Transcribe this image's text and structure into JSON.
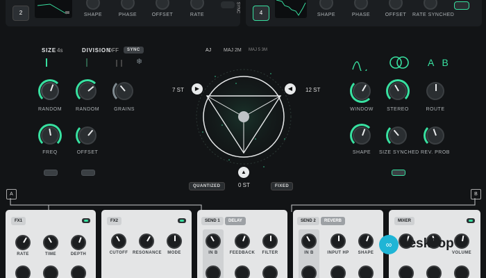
{
  "lfo_left": {
    "number": "2",
    "knobs": [
      "SHAPE",
      "PHASE",
      "OFFSET",
      "RATE"
    ],
    "sync_label": "SYNC"
  },
  "lfo_right": {
    "number": "4",
    "knobs": [
      "SHAPE",
      "PHASE",
      "OFFSET",
      "RATE SYNCHED"
    ]
  },
  "grain": {
    "size_label": "SIZE",
    "size_value": "4s",
    "division_label": "DIVISION",
    "division_value": "OFF",
    "sync_label": "SYNC",
    "knobs": [
      "RANDOM",
      "RANDOM",
      "GRAINS",
      "FREQ",
      "OFFSET"
    ]
  },
  "pitch": {
    "chord_labels": [
      "AJ",
      "MAJ 2M",
      "MAJ 5 3M"
    ],
    "left_st": "7 ST",
    "right_st": "12 ST",
    "bottom_st": "0 ST",
    "quantized_label": "QUANTIZED",
    "fixed_label": "FIXED"
  },
  "window": {
    "route_letters": "A B",
    "knobs": [
      "WINDOW",
      "STEREO",
      "ROUTE",
      "SHAPE",
      "SIZE SYNCHED",
      "REV. PROB"
    ]
  },
  "markers": {
    "a": "A",
    "b": "B"
  },
  "fx1": {
    "title": "FX1",
    "knobs": [
      "RATE",
      "TIME",
      "DEPTH"
    ]
  },
  "fx2": {
    "title": "FX2",
    "knobs": [
      "CUTOFF",
      "RESONANCE",
      "MODE"
    ]
  },
  "send1": {
    "title": "SEND 1",
    "type": "DELAY",
    "knobs": [
      "IN B",
      "FEEDBACK",
      "FILTER"
    ]
  },
  "send2": {
    "title": "SEND 2",
    "type": "REVERB",
    "knobs": [
      "IN B",
      "INPUT HP",
      "SHAPE"
    ]
  },
  "mixer": {
    "title": "MIXER",
    "knobs": [
      "",
      "",
      "VOLUME"
    ]
  },
  "watermark": {
    "text": "4eskTop"
  },
  "colors": {
    "accent": "#38e0a0",
    "background": "#121416",
    "panel_light": "#e4e5e6"
  }
}
